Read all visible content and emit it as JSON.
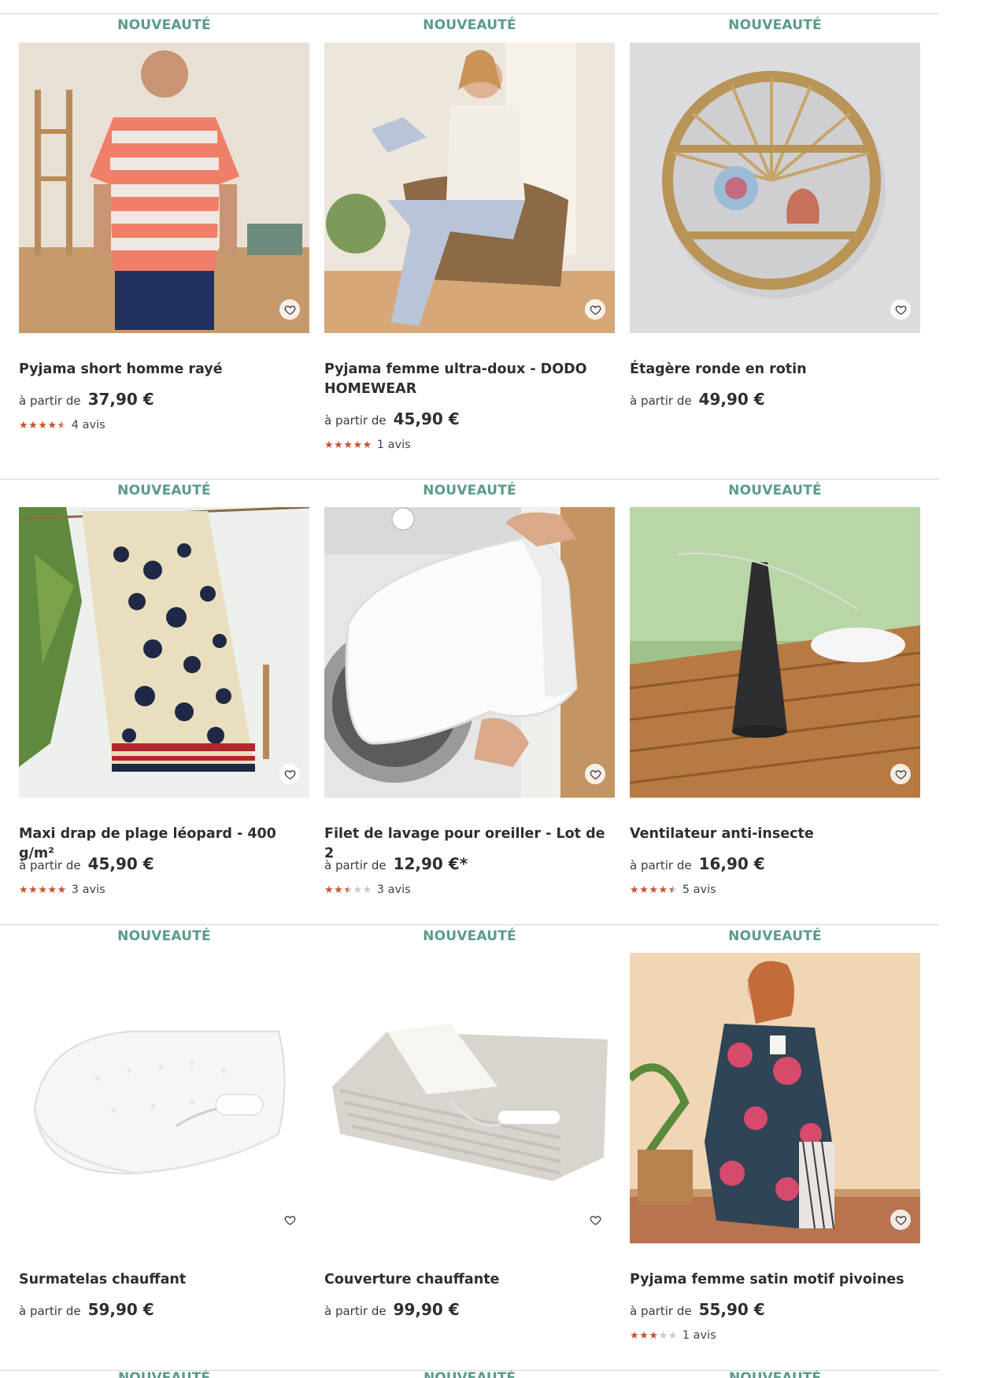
{
  "badge": "NOUVEAUTÉ",
  "price_prefix": "à partir de",
  "favorite_icon": "heart-outline-icon",
  "colors": {
    "badge": "#5c9a8f",
    "star": "#c8522f",
    "text": "#2e2e2e",
    "divider": "#d6d6d6"
  },
  "products": [
    {
      "name": "Pyjama short homme rayé",
      "price": "37,90 €",
      "rating": 4.5,
      "reviews": "4 avis",
      "image": "man-striped-pyjama-photo"
    },
    {
      "name": "Pyjama femme ultra-doux - DODO HOMEWEAR",
      "price": "45,90 €",
      "rating": 5,
      "reviews": "1 avis",
      "image": "woman-pyjama-chair-photo"
    },
    {
      "name": "Étagère ronde en rotin",
      "price": "49,90 €",
      "image": "round-rattan-shelf-photo"
    },
    {
      "name": "Maxi drap de plage léopard - 400 g/m²",
      "price": "45,90 €",
      "rating": 5,
      "reviews": "3 avis",
      "image": "leopard-beach-towel-photo"
    },
    {
      "name": "Filet de lavage pour oreiller - Lot de 2",
      "price": "12,90 €*",
      "rating": 2.5,
      "reviews": "3 avis",
      "image": "pillow-wash-bag-photo"
    },
    {
      "name": "Ventilateur anti-insecte",
      "price": "16,90 €",
      "rating": 4.5,
      "reviews": "5 avis",
      "image": "anti-insect-fan-photo"
    },
    {
      "name": "Surmatelas chauffant",
      "price": "59,90 €",
      "image": "heated-mattress-pad-photo"
    },
    {
      "name": "Couverture chauffante",
      "price": "99,90 €",
      "image": "heated-blanket-photo"
    },
    {
      "name": "Pyjama femme satin motif pivoines",
      "price": "55,90 €",
      "rating": 3,
      "reviews": "1 avis",
      "image": "woman-satin-peony-pyjama-photo"
    }
  ]
}
